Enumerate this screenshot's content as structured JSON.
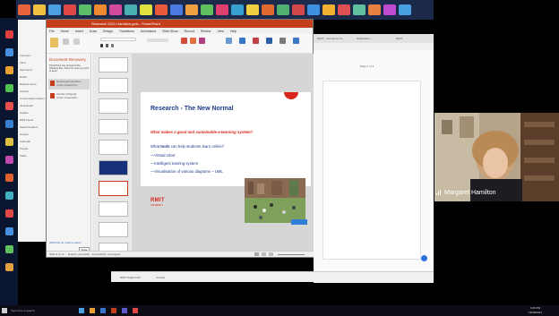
{
  "ppt": {
    "title": "Research 2021 Hamilton.pptx - PowerPoint",
    "menu": [
      "File",
      "Home",
      "Insert",
      "Draw",
      "Design",
      "Transitions",
      "Animations",
      "Slide Show",
      "Record",
      "Review",
      "View",
      "Help"
    ],
    "recovery_title": "Document Recovery",
    "recovery_text": "PowerPoint has recovered the following files. Save the ones you wish to keep.",
    "recovery_items": [
      {
        "name": "Sanford.pptx [AutoRec...",
        "note": "Version created from..."
      },
      {
        "name": "Hamilton [Original]",
        "note": "Version created last t..."
      }
    ],
    "recovery_link": "Which file do I want to save?",
    "close_btn": "Close",
    "status_left": "Slide 8 of 12",
    "status_mid": "English (Australia)",
    "status_access": "Accessibility: Investigate"
  },
  "slide": {
    "title": "Research - The New Normal",
    "question": "What makes a good and sustainable e-learning system?",
    "lead_pre": "What ",
    "lead_bold": "tools",
    "lead_post": " can help students learn online?",
    "bullets": [
      "—Virtual robot",
      "—Intelligent tutoring system",
      "—Visualisation of various diagrams – UML"
    ],
    "logo_text": "RMIT",
    "logo_sub": "UNIVERSITY",
    "colors": {
      "title": "#1f3a8a",
      "accent": "#d9261c"
    }
  },
  "background": {
    "left_list": [
      "Favorites",
      "Inbox",
      "Sent Items",
      "Drafts",
      "Deleted Items",
      "Archive",
      "Conversation History",
      "Junk Email",
      "Outbox",
      "RSS Feeds",
      "Search Folders",
      "Groups",
      "Calendar",
      "People",
      "Tasks"
    ],
    "right_tabs": [
      "RMIT - Canvas for M...",
      "Notification...",
      "RMIT..."
    ],
    "mid_text": "Page 1 of 4",
    "bottom_tabs": [
      "RMIT Digital Hub",
      "Canvas"
    ],
    "url": "https://www.rmit.edu.au"
  },
  "webcam": {
    "name": "Margaret Hamilton",
    "signal_icon": "signal-bars-icon"
  },
  "taskbar": {
    "search_placeholder": "Type here to search",
    "time": "6:09 PM",
    "date": "19/08/2021"
  }
}
